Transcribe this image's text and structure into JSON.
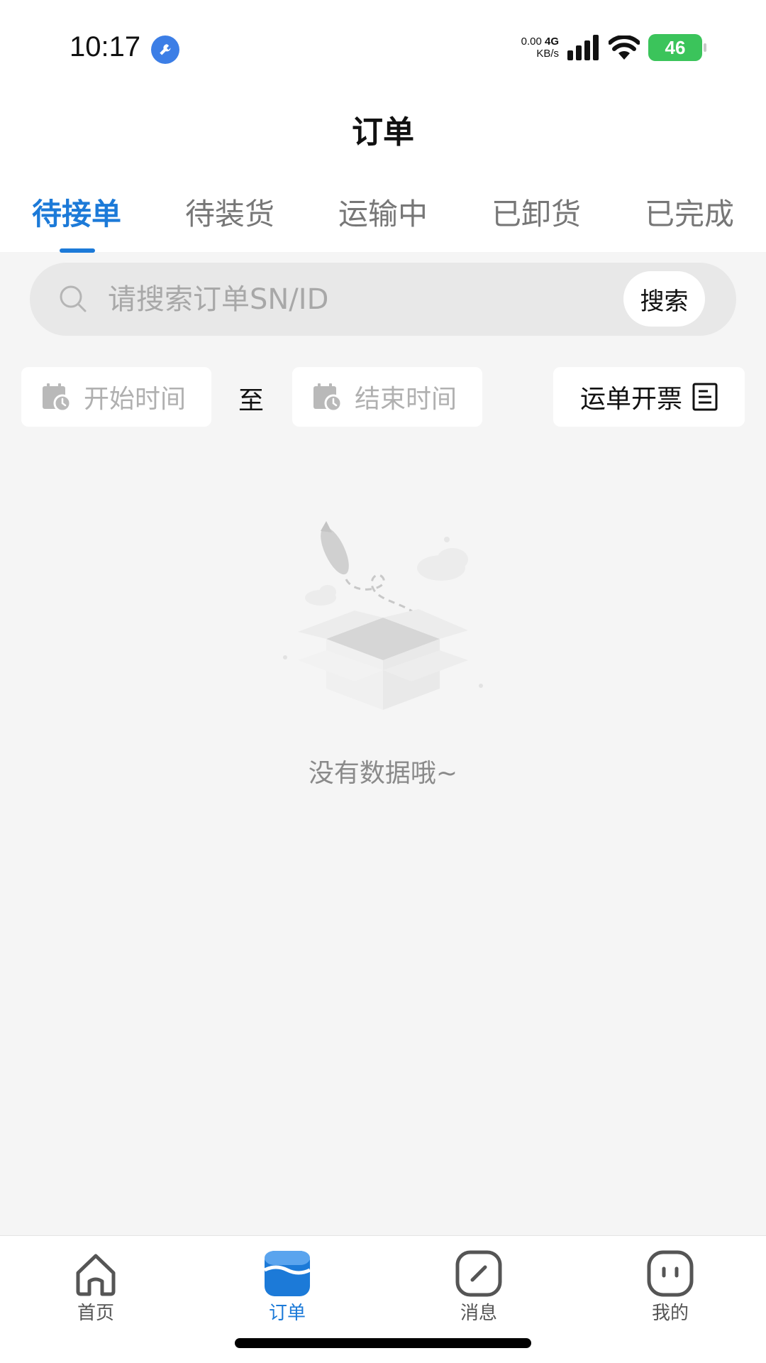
{
  "status_bar": {
    "time": "10:17",
    "net_speed_value": "0.00",
    "net_speed_unit": "KB/s",
    "network_type": "4G",
    "battery": "46",
    "icons": [
      "wrench-icon",
      "signal-icon",
      "wifi-icon",
      "battery-icon"
    ]
  },
  "header": {
    "title": "订单"
  },
  "tabs": [
    {
      "label": "待接单",
      "active": true
    },
    {
      "label": "待装货",
      "active": false
    },
    {
      "label": "运输中",
      "active": false
    },
    {
      "label": "已卸货",
      "active": false
    },
    {
      "label": "已完成",
      "active": false
    }
  ],
  "search": {
    "placeholder": "请搜索订单SN/ID",
    "button_label": "搜索"
  },
  "filters": {
    "start_placeholder": "开始时间",
    "to_label": "至",
    "end_placeholder": "结束时间",
    "invoice_label": "运单开票"
  },
  "empty_state": {
    "text": "没有数据哦~"
  },
  "bottom_nav": [
    {
      "label": "首页",
      "icon": "home-icon",
      "active": false
    },
    {
      "label": "订单",
      "icon": "order-icon",
      "active": true
    },
    {
      "label": "消息",
      "icon": "message-icon",
      "active": false
    },
    {
      "label": "我的",
      "icon": "profile-icon",
      "active": false
    }
  ],
  "colors": {
    "accent": "#1c7ad8",
    "background": "#f5f5f5",
    "battery": "#3bc45b"
  }
}
